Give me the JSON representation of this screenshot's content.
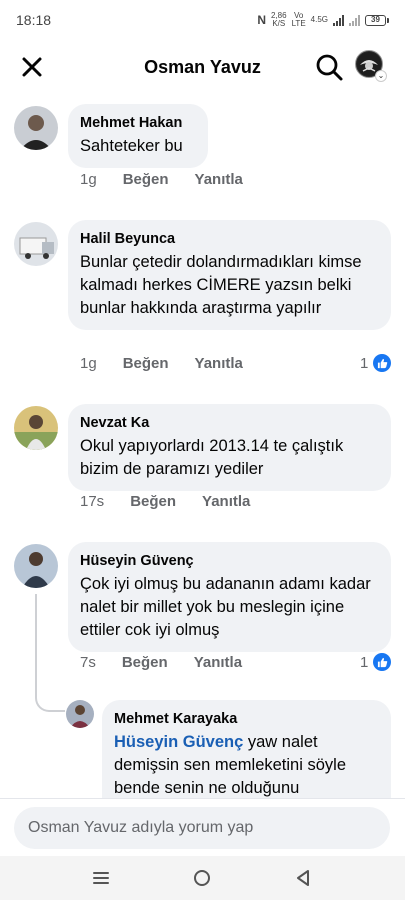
{
  "status_bar": {
    "time": "18:18",
    "net_speed": "2,86",
    "net_unit": "K/S",
    "vo": "Vo",
    "lte": "LTE",
    "gen": "4.5G",
    "battery": "39"
  },
  "header": {
    "title": "Osman Yavuz"
  },
  "comments": [
    {
      "author": "Mehmet Hakan",
      "text": "Sahteteker bu",
      "time": "1g",
      "like_label": "Beğen",
      "reply_label": "Yanıtla",
      "likes": ""
    },
    {
      "author": "Halil Beyunca",
      "text": "Bunlar çetedir dolandırmadıkları kimse kalmadı herkes CİMERE yazsın belki bunlar hakkında araştırma yapılır",
      "time": "1g",
      "like_label": "Beğen",
      "reply_label": "Yanıtla",
      "likes": "1"
    },
    {
      "author": "Nevzat Ka",
      "text": "Okul yapıyorlardı 2013.14 te çalıştık bizim de paramızı yediler",
      "time": "17s",
      "like_label": "Beğen",
      "reply_label": "Yanıtla",
      "likes": ""
    },
    {
      "author": "Hüseyin Güvenç",
      "text": "Çok iyi olmuş bu adananın adamı kadar nalet bir millet yok bu meslegin içine ettiler cok iyi olmuş",
      "time": "7s",
      "like_label": "Beğen",
      "reply_label": "Yanıtla",
      "likes": "1"
    }
  ],
  "reply": {
    "author": "Mehmet Karayaka",
    "mention": "Hüseyin Güvenç",
    "text": " yaw nalet demişsin sen memleketini söyle bende senin ne olduğunu"
  },
  "composer": {
    "placeholder": "Osman Yavuz adıyla yorum yap"
  },
  "icons": {
    "close": "close-icon",
    "search": "search-icon",
    "like": "thumbs-up-icon",
    "nav_recents": "menu-icon",
    "nav_home": "home-circle-icon",
    "nav_back": "back-triangle-icon"
  },
  "colors": {
    "like_blue": "#1877f2",
    "mention_blue": "#1a5fb4",
    "bubble_bg": "#f0f2f5",
    "meta_gray": "#65676b"
  }
}
